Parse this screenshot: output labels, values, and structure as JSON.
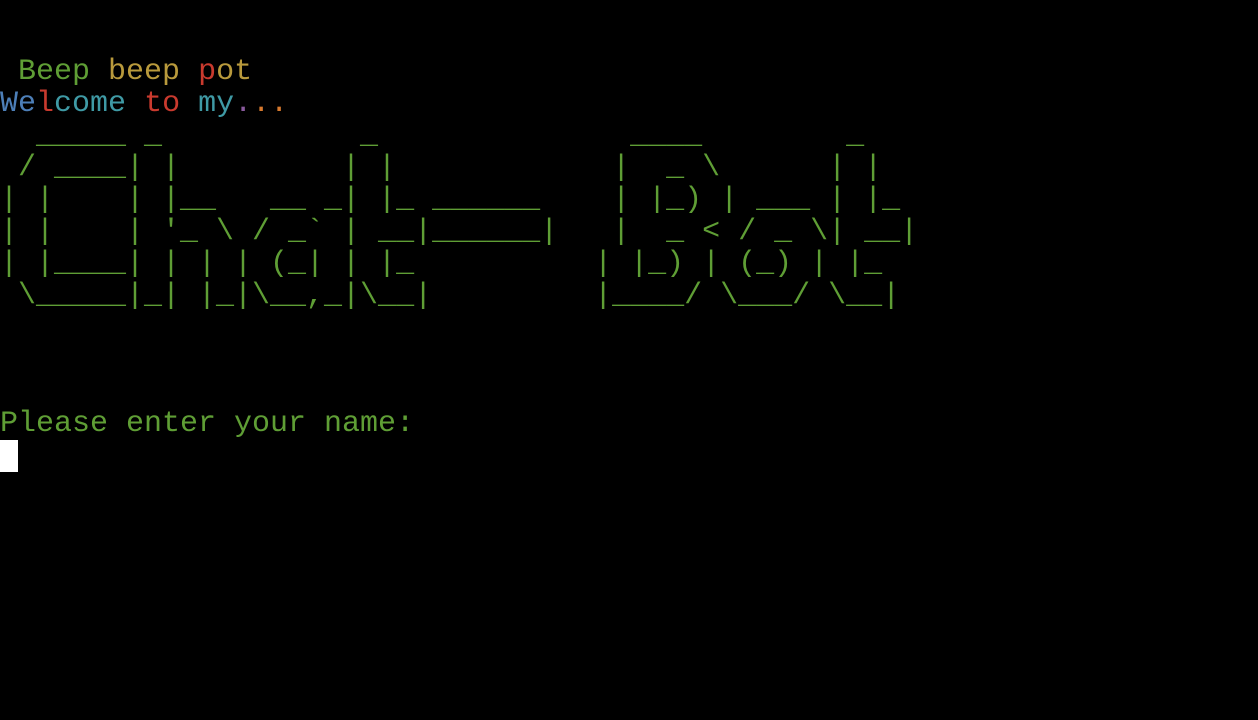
{
  "colors": {
    "background": "#000000",
    "green": "#5f9e35",
    "olive": "#b99a3c",
    "red": "#c93a2e",
    "blue": "#4d7fb8",
    "teal": "#3f9aa5",
    "purple": "#8a5a9e",
    "orange": "#d87a2e",
    "cursor": "#ffffff"
  },
  "header": {
    "beep_line": [
      {
        "text": " ",
        "color": "#5f9e35"
      },
      {
        "text": "Beep",
        "color": "#5f9e35"
      },
      {
        "text": " ",
        "color": "#5f9e35"
      },
      {
        "text": "beep",
        "color": "#b99a3c"
      },
      {
        "text": " ",
        "color": "#5f9e35"
      },
      {
        "text": "p",
        "color": "#c93a2e"
      },
      {
        "text": "ot",
        "color": "#b99a3c"
      }
    ],
    "welcome_line": [
      {
        "text": "We",
        "color": "#4d7fb8"
      },
      {
        "text": "l",
        "color": "#c93a2e"
      },
      {
        "text": "come",
        "color": "#3f9aa5"
      },
      {
        "text": " ",
        "color": "#5f9e35"
      },
      {
        "text": "to",
        "color": "#c93a2e"
      },
      {
        "text": " ",
        "color": "#5f9e35"
      },
      {
        "text": "my",
        "color": "#3f9aa5"
      },
      {
        "text": ".",
        "color": "#8a5a9e"
      },
      {
        "text": ".",
        "color": "#d87a2e"
      },
      {
        "text": ".",
        "color": "#d87a2e"
      }
    ]
  },
  "ascii_art": {
    "line0": "  _____ _           _              ____        _   ",
    "line1": " / ____| |         | |            |  _ \\      | |  ",
    "line2": "| |    | |__   __ _| |_ ______    | |_) | ___ | |_ ",
    "line3": "| |    | '_ \\ / _` | __|______|   |  _ < / _ \\| __|",
    "line4": "| |____| | | | (_| | |_          | |_) | (_) | |_ ",
    "line5": " \\_____|_| |_|\\__,_|\\__|         |____/ \\___/ \\__|"
  },
  "prompt": {
    "text": "Please enter your name:",
    "input_value": ""
  }
}
